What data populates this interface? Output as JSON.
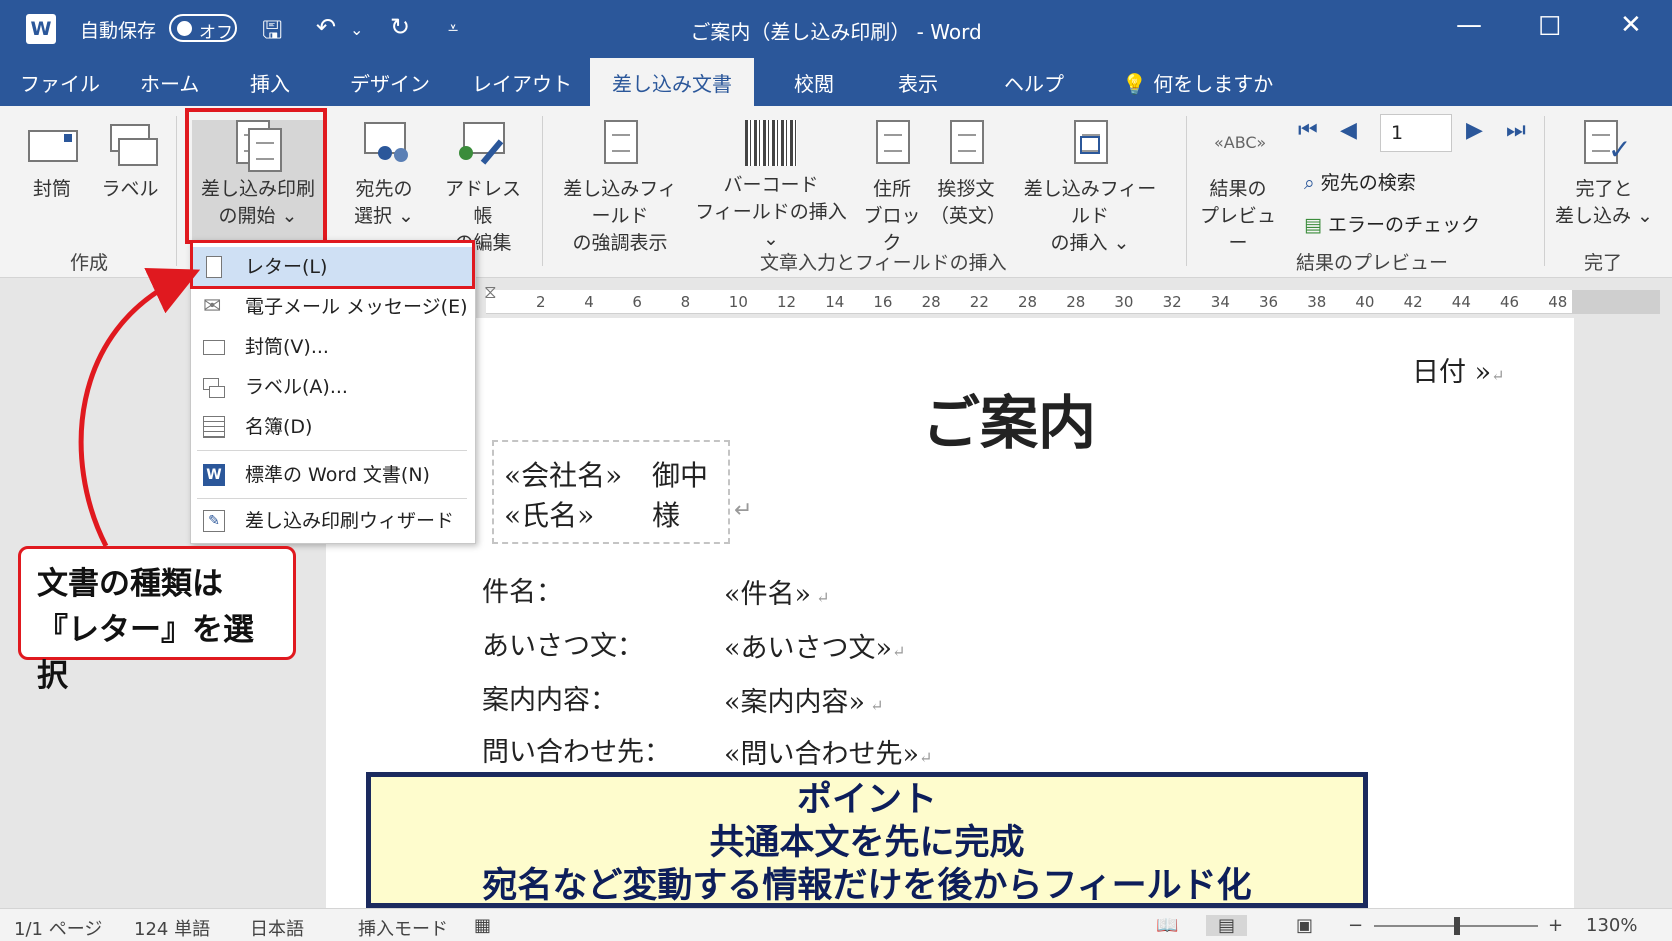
{
  "titlebar": {
    "autosave_label": "自動保存",
    "autosave_state": "オフ",
    "title": "ご案内（差し込み印刷） - Word",
    "brand_color": "#2b579a"
  },
  "tabs": [
    {
      "label": "ファイル"
    },
    {
      "label": "ホーム"
    },
    {
      "label": "挿入"
    },
    {
      "label": "デザイン"
    },
    {
      "label": "レイアウト"
    },
    {
      "label": "差し込み文書",
      "active": true
    },
    {
      "label": "校閲"
    },
    {
      "label": "表示"
    },
    {
      "label": "ヘルプ"
    }
  ],
  "tellme": "何をしますか",
  "ribbon": {
    "envelope": "封筒",
    "label": "ラベル",
    "start_merge_1": "差し込み印刷",
    "start_merge_2": "の開始 ⌄",
    "select_recipients_1": "宛先の",
    "select_recipients_2": "選択 ⌄",
    "edit_list_1": "アドレス帳",
    "edit_list_2": "の編集",
    "highlight_fields_1": "差し込みフィールド",
    "highlight_fields_2": "の強調表示",
    "barcode_1": "バーコード",
    "barcode_2": "フィールドの挿入 ⌄",
    "address_block_1": "住所",
    "address_block_2": "ブロック",
    "greeting_1": "挨拶文",
    "greeting_2": "（英文）",
    "insert_field_1": "差し込みフィールド",
    "insert_field_2": "の挿入 ⌄",
    "preview_1": "結果の",
    "preview_2": "プレビュー",
    "record_number": "1",
    "find_recipient": "宛先の検索",
    "check_errors": "エラーのチェック",
    "finish_1": "完了と",
    "finish_2": "差し込み ⌄",
    "group_create": "作成",
    "group_write": "文章入力とフィールドの挿入",
    "group_preview": "結果のプレビュー",
    "group_finish": "完了"
  },
  "menu": {
    "items": [
      {
        "label": "レター(L)"
      },
      {
        "label": "電子メール メッセージ(E)"
      },
      {
        "label": "封筒(V)..."
      },
      {
        "label": "ラベル(A)..."
      },
      {
        "label": "名簿(D)"
      },
      {
        "label": "標準の Word 文書(N)"
      },
      {
        "label": "差し込み印刷ウィザード(W)..."
      }
    ]
  },
  "ruler_ticks": [
    "2",
    "4",
    "6",
    "8",
    "10",
    "12",
    "14",
    "16",
    "28",
    "22",
    "28",
    "28",
    "30",
    "32",
    "34",
    "36",
    "38",
    "40",
    "42",
    "44",
    "46",
    "48"
  ],
  "document": {
    "date": "日付 »",
    "title": "ご案内",
    "company": "«会社名»",
    "company_suffix": "御中",
    "person": "«氏名»",
    "person_suffix": "様",
    "rows": [
      {
        "label": "件名：",
        "value": "«件名»"
      },
      {
        "label": "あいさつ文：",
        "value": "«あいさつ文»"
      },
      {
        "label": "案内内容：",
        "value": "«案内内容»"
      },
      {
        "label": "問い合わせ先：",
        "value": "«問い合わせ先»"
      }
    ]
  },
  "callout": {
    "line1": "文書の種類は",
    "line2": "『レター』を選択"
  },
  "point": {
    "line1": "ポイント",
    "line2": "共通本文を先に完成",
    "line3": "宛名など変動する情報だけを後からフィールド化"
  },
  "status": {
    "page": "1/1 ページ",
    "words": "124 単語",
    "language": "日本語",
    "mode": "挿入モード",
    "zoom": "130%"
  }
}
